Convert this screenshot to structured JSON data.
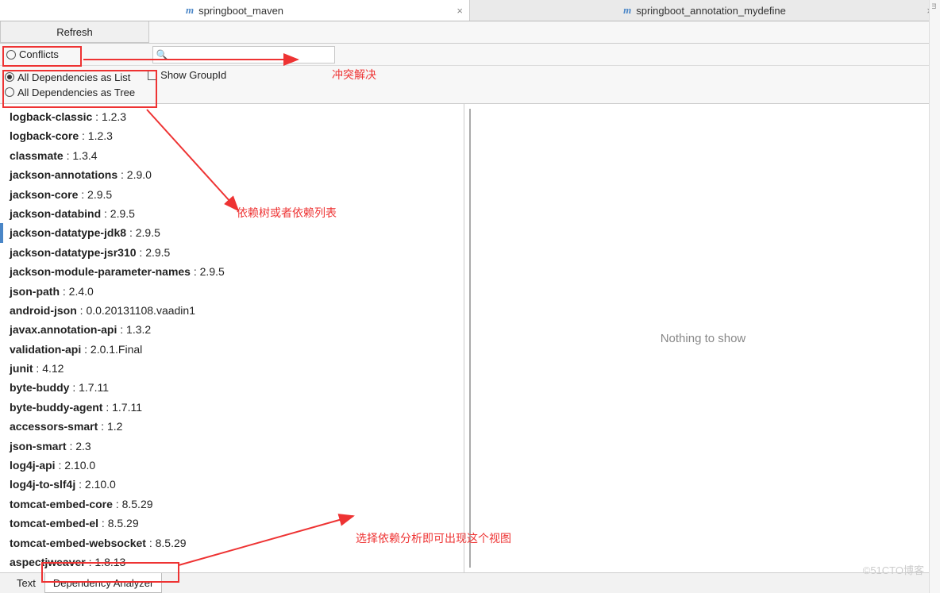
{
  "tabs": {
    "left": {
      "icon": "m",
      "label": "springboot_maven"
    },
    "right": {
      "icon": "m",
      "label": "springboot_annotation_mydefine"
    }
  },
  "toolbar": {
    "refresh": "Refresh"
  },
  "filters": {
    "conflicts": "Conflicts",
    "all_list": "All Dependencies as List",
    "all_tree": "All Dependencies as Tree",
    "show_groupid": "Show GroupId",
    "search_placeholder": ""
  },
  "dependencies": [
    {
      "name": "logback-classic",
      "version": "1.2.3",
      "selected": false
    },
    {
      "name": "logback-core",
      "version": "1.2.3",
      "selected": false
    },
    {
      "name": "classmate",
      "version": "1.3.4",
      "selected": false
    },
    {
      "name": "jackson-annotations",
      "version": "2.9.0",
      "selected": false
    },
    {
      "name": "jackson-core",
      "version": "2.9.5",
      "selected": false
    },
    {
      "name": "jackson-databind",
      "version": "2.9.5",
      "selected": false
    },
    {
      "name": "jackson-datatype-jdk8",
      "version": "2.9.5",
      "selected": true
    },
    {
      "name": "jackson-datatype-jsr310",
      "version": "2.9.5",
      "selected": false
    },
    {
      "name": "jackson-module-parameter-names",
      "version": "2.9.5",
      "selected": false
    },
    {
      "name": "json-path",
      "version": "2.4.0",
      "selected": false
    },
    {
      "name": "android-json",
      "version": "0.0.20131108.vaadin1",
      "selected": false
    },
    {
      "name": "javax.annotation-api",
      "version": "1.3.2",
      "selected": false
    },
    {
      "name": "validation-api",
      "version": "2.0.1.Final",
      "selected": false
    },
    {
      "name": "junit",
      "version": "4.12",
      "selected": false
    },
    {
      "name": "byte-buddy",
      "version": "1.7.11",
      "selected": false
    },
    {
      "name": "byte-buddy-agent",
      "version": "1.7.11",
      "selected": false
    },
    {
      "name": "accessors-smart",
      "version": "1.2",
      "selected": false
    },
    {
      "name": "json-smart",
      "version": "2.3",
      "selected": false
    },
    {
      "name": "log4j-api",
      "version": "2.10.0",
      "selected": false
    },
    {
      "name": "log4j-to-slf4j",
      "version": "2.10.0",
      "selected": false
    },
    {
      "name": "tomcat-embed-core",
      "version": "8.5.29",
      "selected": false
    },
    {
      "name": "tomcat-embed-el",
      "version": "8.5.29",
      "selected": false
    },
    {
      "name": "tomcat-embed-websocket",
      "version": "8.5.29",
      "selected": false
    },
    {
      "name": "aspectjweaver",
      "version": "1.8.13",
      "selected": false
    }
  ],
  "right_pane": {
    "empty_text": "Nothing to show"
  },
  "bottom_tabs": {
    "text": "Text",
    "analyzer": "Dependency Analyzer"
  },
  "annotations": {
    "a1": "冲突解决",
    "a2": "依赖树或者依赖列表",
    "a3": "选择依赖分析即可出现这个视图"
  },
  "watermark": "©51CTO博客"
}
